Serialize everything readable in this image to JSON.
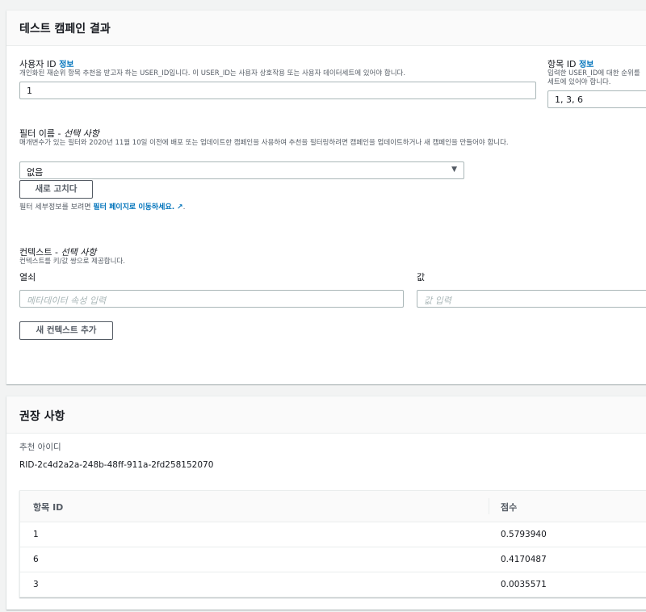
{
  "test_panel": {
    "title": "테스트 캠페인 결과",
    "user_id": {
      "label": "사용자 ID",
      "info": "정보",
      "desc": "개인화된 재순위 항목 추천을 받고자 하는 USER_ID입니다. 이 USER_ID는 사용자 상호작용 또는 사용자 데이터세트에 있어야 합니다.",
      "value": "1"
    },
    "item_id": {
      "label": "항목 ID",
      "info": "정보",
      "desc": "입력한 USER_ID에 대한 순위를",
      "desc2": "세트에 있어야 합니다.",
      "value": "1, 3, 6"
    },
    "filter": {
      "label": "필터 이름 - ",
      "optional": "선택 사항",
      "desc": "매개변수가 있는 필터와 2020년 11월 10일 이전에 배포 또는 업데이트한 캠페인을 사용하여 추천을 필터링하려면 캠페인을 업데이트하거나 새 캠페인을 만들어야 합니다.",
      "value": "없음",
      "refresh": "새로 고치다",
      "hint": "필터 세부정보를 보려면 ",
      "link": "필터 페이지로 이동하세요.",
      "hint_end": "."
    },
    "context": {
      "label": "컨텍스트 - ",
      "optional": "선택 사항",
      "desc": "컨텍스트를 키/값 쌍으로 제공합니다.",
      "key_label": "열쇠",
      "value_label": "값",
      "key_placeholder": "메타데이터 속성 입력",
      "value_placeholder": "값 입력",
      "add": "새 컨텍스트 추가"
    }
  },
  "recs_panel": {
    "title": "권장 사항",
    "rec_id_label": "추천 아이디",
    "rec_id": "RID-2c4d2a2a-248b-48ff-911a-2fd258152070",
    "columns": [
      "항목 ID",
      "점수"
    ],
    "rows": [
      [
        "1",
        "0.5793940"
      ],
      [
        "6",
        "0.4170487"
      ],
      [
        "3",
        "0.0035571"
      ]
    ]
  }
}
